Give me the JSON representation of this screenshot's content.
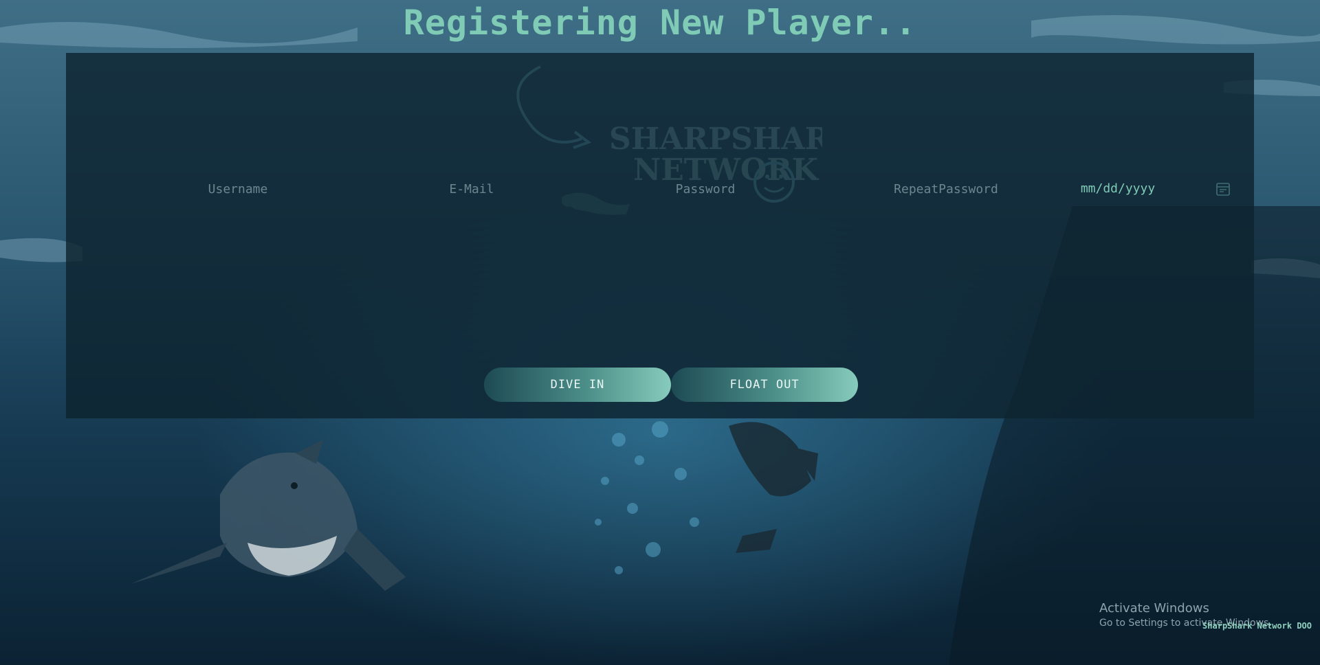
{
  "page": {
    "title": "Registering New Player.."
  },
  "logo": {
    "line1": "SHARPSHARK",
    "line2": "NETWORK"
  },
  "form": {
    "username_placeholder": "Username",
    "email_placeholder": "E-Mail",
    "password_placeholder": "Password",
    "repeat_password_placeholder": "RepeatPassword",
    "date_placeholder": "mm/dd/yyyy",
    "calendar_icon": "calendar-icon"
  },
  "buttons": {
    "dive_in": "DIVE IN",
    "float_out": "FLOAT OUT"
  },
  "windows_watermark": {
    "title": "Activate Windows",
    "subtitle": "Go to Settings to activate Windows."
  },
  "footer": {
    "company": "SharpShark Network DOO"
  },
  "colors": {
    "accent": "#7fcbb6",
    "panel": "#0d2330",
    "background": "#0f2a3c"
  }
}
